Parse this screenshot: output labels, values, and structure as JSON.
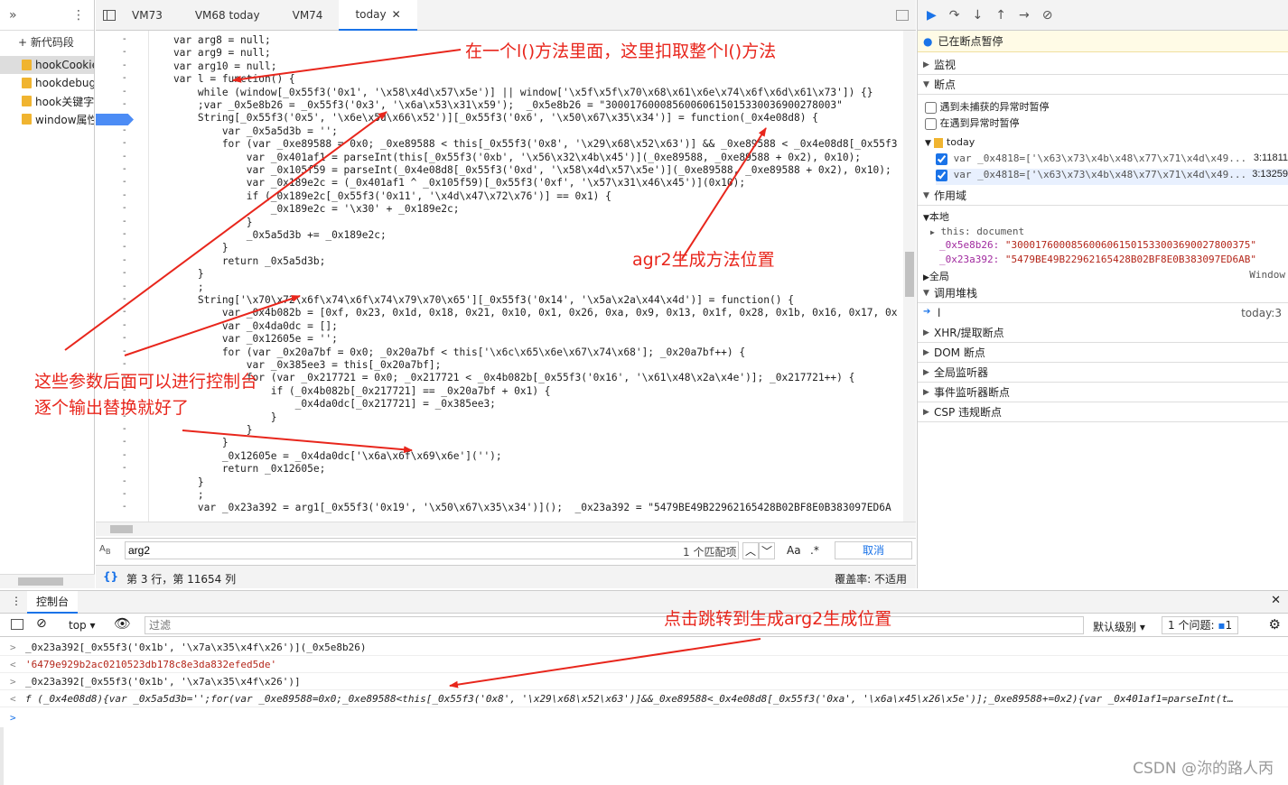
{
  "nav": {
    "new_snippet": "+ 新代码段",
    "items": [
      {
        "label": "hookCookie"
      },
      {
        "label": "hookdebug"
      },
      {
        "label": "hook关键字"
      },
      {
        "label": "window属性"
      }
    ]
  },
  "tabs": [
    "VM73",
    "VM68 today",
    "VM74",
    "today"
  ],
  "code_lines": [
    "    var arg8 = null;",
    "    var arg9 = null;",
    "    var arg10 = null;",
    "    var l = function() {",
    "        while (window[_0x55f3('0x1', '\\x58\\x4d\\x57\\x5e')] || window['\\x5f\\x5f\\x70\\x68\\x61\\x6e\\x74\\x6f\\x6d\\x61\\x73']) {}",
    "        ;var _0x5e8b26 = _0x55f3('0x3', '\\x6a\\x53\\x31\\x59');  _0x5e8b26 = \"30001760008560060615015330036900278003\"",
    "        String[_0x55f3('0x5', '\\x6e\\x5d\\x66\\x52')][_0x55f3('0x6', '\\x50\\x67\\x35\\x34')] = function(_0x4e08d8) {",
    "            var _0x5a5d3b = '';",
    "            for (var _0xe89588 = 0x0; _0xe89588 < this[_0x55f3('0x8', '\\x29\\x68\\x52\\x63')] && _0xe89588 < _0x4e08d8[_0x55f3",
    "                var _0x401af1 = parseInt(this[_0x55f3('0xb', '\\x56\\x32\\x4b\\x45')](_0xe89588, _0xe89588 + 0x2), 0x10);",
    "                var _0x105f59 = parseInt(_0x4e08d8[_0x55f3('0xd', '\\x58\\x4d\\x57\\x5e')](_0xe89588, _0xe89588 + 0x2), 0x10);",
    "                var _0x189e2c = (_0x401af1 ^ _0x105f59)[_0x55f3('0xf', '\\x57\\x31\\x46\\x45')](0x10);",
    "                if (_0x189e2c[_0x55f3('0x11', '\\x4d\\x47\\x72\\x76')] == 0x1) {",
    "                    _0x189e2c = '\\x30' + _0x189e2c;",
    "                }",
    "                _0x5a5d3b += _0x189e2c;",
    "            }",
    "            return _0x5a5d3b;",
    "        }",
    "        ;",
    "        String['\\x70\\x72\\x6f\\x74\\x6f\\x74\\x79\\x70\\x65'][_0x55f3('0x14', '\\x5a\\x2a\\x44\\x4d')] = function() {",
    "            var _0x4b082b = [0xf, 0x23, 0x1d, 0x18, 0x21, 0x10, 0x1, 0x26, 0xa, 0x9, 0x13, 0x1f, 0x28, 0x1b, 0x16, 0x17, 0x",
    "            var _0x4da0dc = [];",
    "            var _0x12605e = '';",
    "            for (var _0x20a7bf = 0x0; _0x20a7bf < this['\\x6c\\x65\\x6e\\x67\\x74\\x68']; _0x20a7bf++) {",
    "                var _0x385ee3 = this[_0x20a7bf];",
    "                for (var _0x217721 = 0x0; _0x217721 < _0x4b082b[_0x55f3('0x16', '\\x61\\x48\\x2a\\x4e')]; _0x217721++) {",
    "                    if (_0x4b082b[_0x217721] == _0x20a7bf + 0x1) {",
    "                        _0x4da0dc[_0x217721] = _0x385ee3;",
    "                    }",
    "                }",
    "            }",
    "            _0x12605e = _0x4da0dc['\\x6a\\x6f\\x69\\x6e']('');",
    "            return _0x12605e;",
    "        }",
    "        ;",
    "        var _0x23a392 = arg1[_0x55f3('0x19', '\\x50\\x67\\x35\\x34')]();  _0x23a392 = \"5479BE49B22962165428B02BF8E0B383097ED6A"
  ],
  "search": {
    "value": "arg2",
    "match_count": "1 个匹配项",
    "case_label": "Aa",
    "regex_label": ".*",
    "cancel": "取消"
  },
  "status": {
    "position": "第 3 行，第 11654 列",
    "coverage": "覆盖率: 不适用"
  },
  "right": {
    "paused": "已在断点暂停",
    "watch": "监视",
    "breakpoints": "断点",
    "pause_uncaught": "遇到未捕获的异常时暂停",
    "pause_caught": "在遇到异常时暂停",
    "bp_file": "today",
    "bp1_code": "var _0x4818=['\\x63\\x73\\x4b\\x48\\x77\\x71\\x4d\\x49...",
    "bp1_loc": "3:11811",
    "bp2_code": "var _0x4818=['\\x63\\x73\\x4b\\x48\\x77\\x71\\x4d\\x49...",
    "bp2_loc": "3:13259",
    "scope": "作用域",
    "local": "本地",
    "this_line": "this: document",
    "var1_name": "_0x5e8b26:",
    "var1_val": "\"3000176000856006061501533003690027800375\"",
    "var2_name": "_0x23a392:",
    "var2_val": "\"5479BE49B22962165428B02BF8E0B383097ED6AB\"",
    "global": "全局",
    "global_val": "Window",
    "callstack": "调用堆栈",
    "frame_name": "l",
    "frame_loc": "today:3",
    "xhr": "XHR/提取断点",
    "dom": "DOM 断点",
    "global_listeners": "全局监听器",
    "event_listeners": "事件监听器断点",
    "csp": "CSP 违规断点"
  },
  "console": {
    "tab": "控制台",
    "context": "top",
    "filter_placeholder": "过滤",
    "level": "默认级别",
    "issues": "1 个问题:",
    "issues_count": "1",
    "lines": [
      "_0x23a392[_0x55f3('0x1b', '\\x7a\\x35\\x4f\\x26')](_0x5e8b26)",
      "'6479e929b2ac0210523db178c8e3da832efed5de'",
      "_0x23a392[_0x55f3('0x1b', '\\x7a\\x35\\x4f\\x26')]",
      "f (_0x4e08d8){var _0x5a5d3b='';for(var _0xe89588=0x0;_0xe89588<this[_0x55f3('0x8', '\\x29\\x68\\x52\\x63')]&&_0xe89588<_0x4e08d8[_0x55f3('0xa', '\\x6a\\x45\\x26\\x5e')];_0xe89588+=0x2){var _0x401af1=parseInt(t…"
    ]
  },
  "annotations": {
    "a1": "在一个l()方法里面，这里扣取整个l()方法",
    "a2": "agr2生成方法位置",
    "a3_line1": "这些参数后面可以进行控制台",
    "a3_line2": "逐个输出替换就好了",
    "a4": "点击跳转到生成arg2生成位置"
  },
  "watermark": "CSDN @沵的路人丙"
}
